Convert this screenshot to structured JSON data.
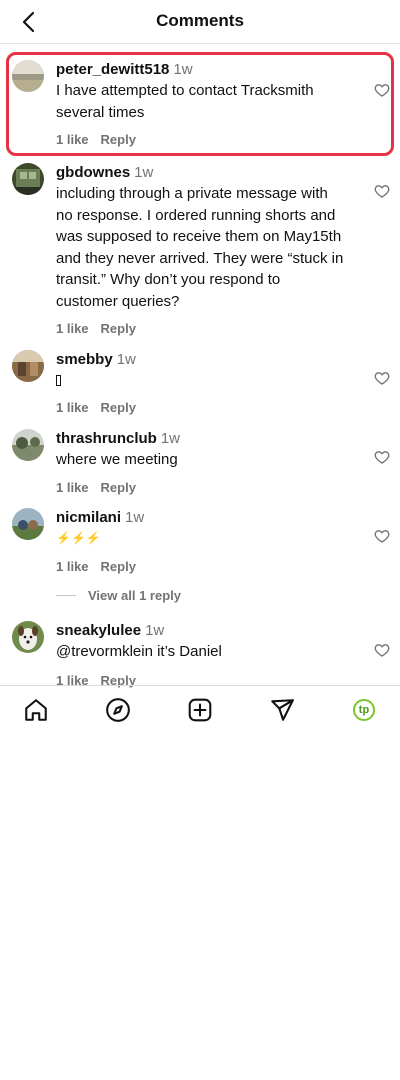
{
  "header": {
    "title": "Comments"
  },
  "comments": [
    {
      "username": "peter_dewitt518",
      "time": "1w",
      "text": "I have attempted to contact Tracksmith several times",
      "likes": "1 like",
      "reply": "Reply"
    },
    {
      "username": "gbdownes",
      "time": "1w",
      "text": "including through a private message with no response. I ordered running shorts and was supposed to receive them on May15th and they never arrived. They were “stuck in transit.” Why don’t you respond to customer queries?",
      "likes": "1 like",
      "reply": "Reply"
    },
    {
      "username": "smebby",
      "time": "1w",
      "text": "",
      "likes": "1 like",
      "reply": "Reply"
    },
    {
      "username": "thrashrunclub",
      "time": "1w",
      "text": "where we meeting",
      "likes": "1 like",
      "reply": "Reply"
    },
    {
      "username": "nicmilani",
      "time": "1w",
      "text": "⚡⚡⚡",
      "likes": "1 like",
      "reply": "Reply"
    },
    {
      "username": "sneakylulee",
      "time": "1w",
      "text": "@trevormklein it’s Daniel",
      "likes": "1 like",
      "reply": "Reply"
    }
  ],
  "view_replies": {
    "label": "View all 1 reply"
  },
  "bottom_nav": {
    "profile_initials": "tp",
    "profile_color": "#7bc62d"
  },
  "colors": {
    "highlight": "#e53244",
    "meta_text": "#737373"
  }
}
